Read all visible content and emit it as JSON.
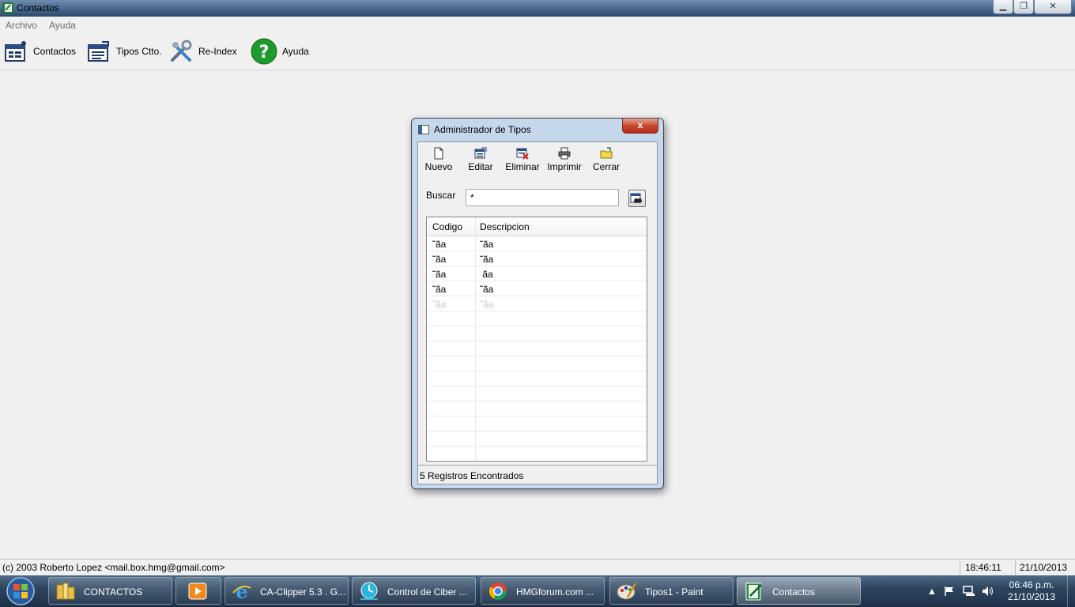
{
  "window": {
    "title": "Contactos",
    "controls": [
      "minimize",
      "restore",
      "close"
    ]
  },
  "menu": {
    "items": [
      "Archivo",
      "Ayuda"
    ]
  },
  "toolbar": {
    "items": [
      {
        "label": "Contactos",
        "icon": "contacts-icon"
      },
      {
        "label": "Tipos Ctto.",
        "icon": "types-icon"
      },
      {
        "label": "Re-Index",
        "icon": "tools-icon"
      },
      {
        "label": "Ayuda",
        "icon": "help-icon"
      }
    ]
  },
  "dialog": {
    "title": "Administrador de Tipos",
    "close_label": "x",
    "toolbar": [
      {
        "label": "Nuevo",
        "icon": "new-document-icon"
      },
      {
        "label": "Editar",
        "icon": "edit-icon"
      },
      {
        "label": "Eliminar",
        "icon": "delete-icon"
      },
      {
        "label": "Imprimir",
        "icon": "print-icon"
      },
      {
        "label": "Cerrar",
        "icon": "close-folder-icon"
      }
    ],
    "search": {
      "label": "Buscar",
      "value": "*"
    },
    "grid": {
      "columns": [
        "Codigo",
        "Descripcion"
      ],
      "rows": [
        [
          "˜ãa",
          "˜ãa"
        ],
        [
          "˜ãa",
          "˜ãa"
        ],
        [
          "˜ãa",
          " ãa"
        ],
        [
          "˜ãa",
          "˜ãa"
        ],
        [
          "˜ãa",
          "˜ãa"
        ]
      ]
    },
    "status": "5 Registros Encontrados"
  },
  "statusbar": {
    "copyright": "(c) 2003 Roberto Lopez <mail.box.hmg@gmail.com>",
    "time": "18:46:11",
    "date": "21/10/2013"
  },
  "taskbar": {
    "buttons": [
      {
        "label": "CONTACTOS",
        "icon": "folder-icon"
      },
      {
        "label": "",
        "icon": "media-player-icon"
      },
      {
        "label": "CA-Clipper 5.3 . G...",
        "icon": "ie-icon"
      },
      {
        "label": "Control de Ciber ...",
        "icon": "clock-app-icon"
      },
      {
        "label": "HMGforum.com ...",
        "icon": "chrome-icon"
      },
      {
        "label": "Tipos1 - Paint",
        "icon": "paint-icon"
      },
      {
        "label": "Contactos",
        "icon": "contacts-app-icon"
      }
    ],
    "clock": {
      "time": "06:46 p.m.",
      "date": "21/10/2013"
    }
  },
  "colors": {
    "taskbar": "#2e4660",
    "dialog_frame": "#c5d7ea",
    "close_button": "#c84a30"
  }
}
